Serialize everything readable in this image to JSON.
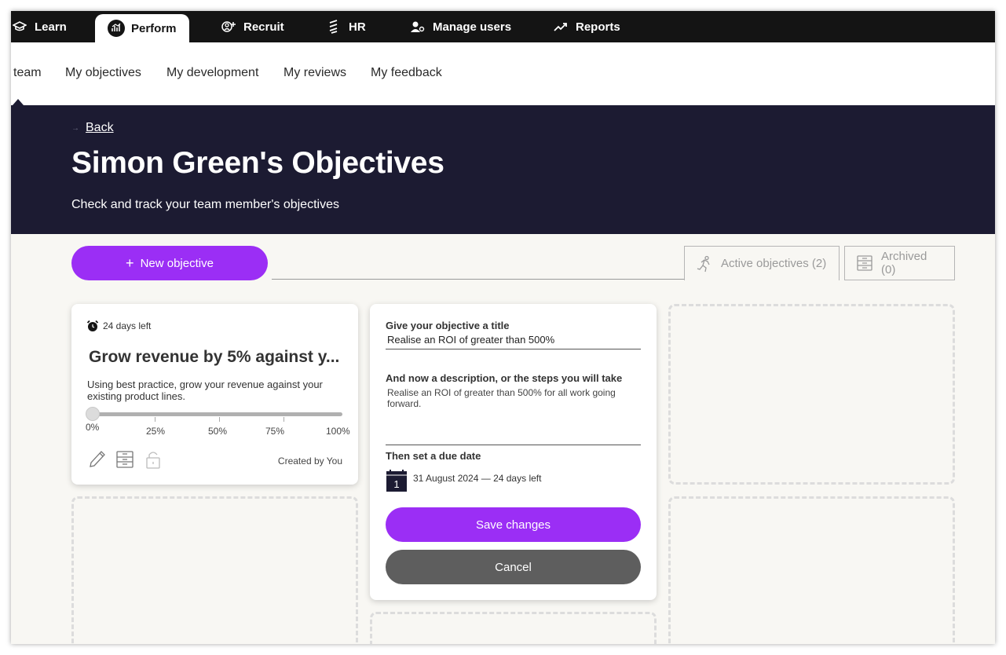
{
  "topnav": {
    "items": [
      {
        "label": "Learn",
        "icon": "graduation-cap-icon"
      },
      {
        "label": "Perform",
        "icon": "performance-chart-icon"
      },
      {
        "label": "Recruit",
        "icon": "recruit-add-user-icon"
      },
      {
        "label": "HR",
        "icon": "hr-icon"
      },
      {
        "label": "Manage users",
        "icon": "user-settings-icon"
      },
      {
        "label": "Reports",
        "icon": "trend-up-icon"
      }
    ]
  },
  "subnav": {
    "items": [
      "team",
      "My objectives",
      "My development",
      "My reviews",
      "My feedback"
    ]
  },
  "header": {
    "back": "Back",
    "title": "Simon Green's Objectives",
    "subtitle": "Check and track your team member's objectives"
  },
  "toolbar": {
    "new_button": "New objective",
    "tab_active": "Active objectives (2)",
    "tab_archived": "Archived (0)"
  },
  "objective_card": {
    "days_left": "24 days left",
    "title": "Grow revenue by 5% against y...",
    "description": "Using best practice, grow your revenue against your existing product lines.",
    "progress": 0,
    "ticks": [
      "0%",
      "25%",
      "50%",
      "75%",
      "100%"
    ],
    "created_by": "Created by You"
  },
  "edit_card": {
    "title_label": "Give your objective a title",
    "title_value": "Realise an ROI of greater than 500%",
    "desc_label": "And now a description, or the steps you will take",
    "desc_value": "Realise an ROI of greater than 500% for all work going forward.",
    "due_label": "Then set a due date",
    "calendar_day": "1",
    "due_value": "31 August 2024 — 24 days left",
    "save_label": "Save changes",
    "cancel_label": "Cancel"
  },
  "colors": {
    "accent": "#9b2ef5",
    "header_bg": "#1c1b32",
    "nav_bg": "#141414",
    "page_bg": "#f8f7f3",
    "cancel_bg": "#5e5e5e"
  }
}
